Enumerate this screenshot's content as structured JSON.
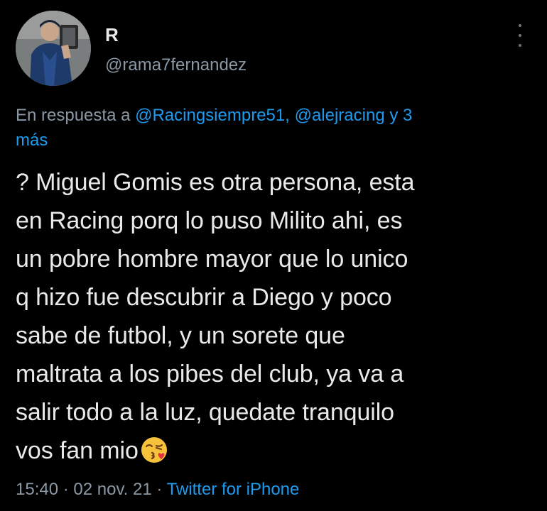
{
  "user": {
    "name": "R",
    "handle": "@rama7fernandez"
  },
  "reply_context": {
    "prefix": "En respuesta a ",
    "mention1": "@Racingsiempre51",
    "sep": ", ",
    "mention2": "@alejracing",
    "suffix": " y 3",
    "line2": "más"
  },
  "tweet_lines": [
    "? Miguel Gomis es otra persona, esta",
    "en Racing porq lo puso Milito ahi, es",
    "un pobre hombre mayor que lo unico",
    "q hizo fue descubrir a Diego y poco",
    "sabe de futbol, y un sorete que",
    "maltrata a los pibes del club, ya va a",
    "salir todo a la luz, quedate tranquilo",
    "vos fan mio"
  ],
  "emoji": "face-blowing-a-kiss",
  "meta": {
    "time": "15:40",
    "dot1": " · ",
    "date": "02 nov. 21",
    "dot2": " · ",
    "source": "Twitter for iPhone"
  },
  "colors": {
    "background": "#000000",
    "text": "#e7e9ea",
    "secondary": "#8b98a5",
    "link": "#1d9bf0"
  }
}
